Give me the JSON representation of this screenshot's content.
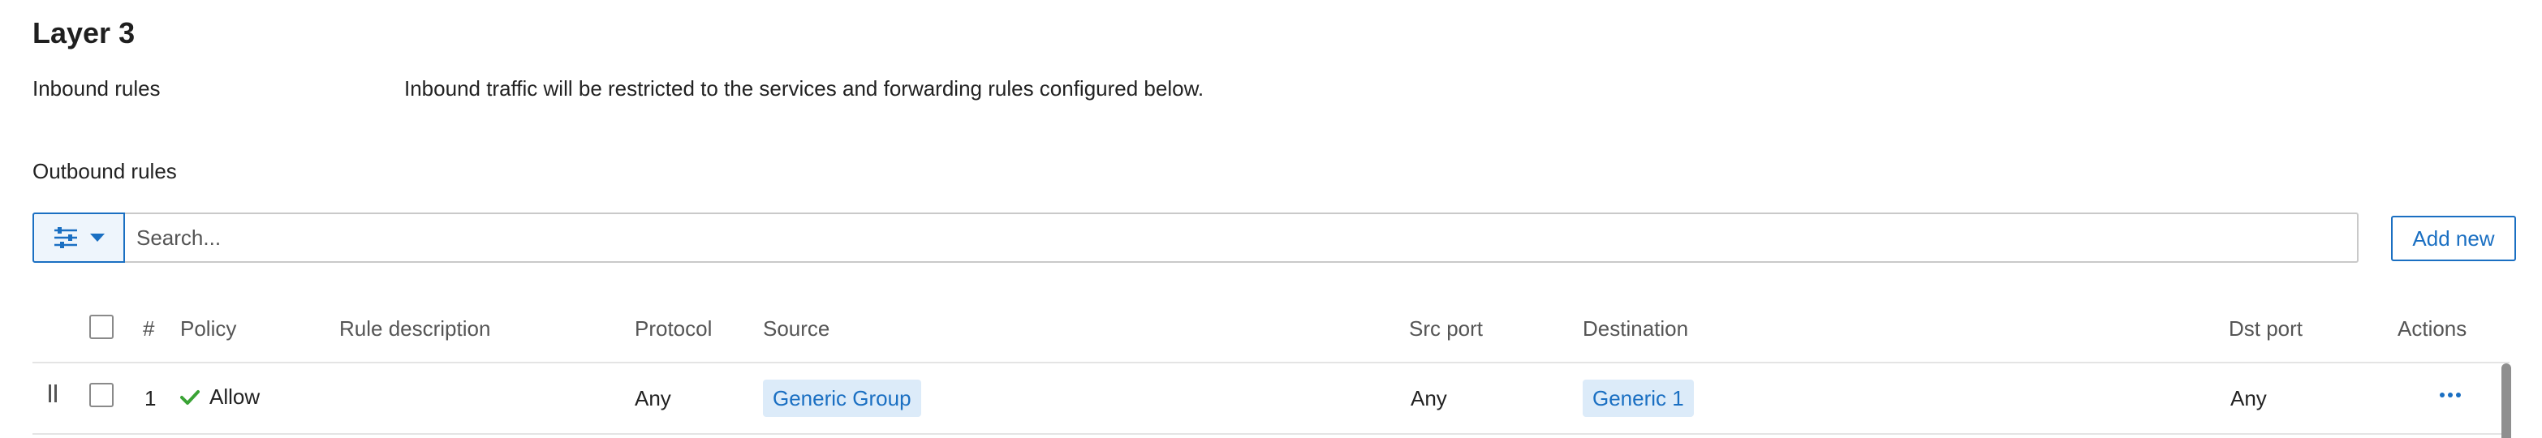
{
  "section": {
    "title": "Layer 3",
    "inbound_label": "Inbound rules",
    "inbound_description": "Inbound traffic will be restricted to the services and forwarding rules configured below.",
    "outbound_label": "Outbound rules"
  },
  "toolbar": {
    "filter_icon": "sliders-icon",
    "search_placeholder": "Search...",
    "add_label": "Add new"
  },
  "table": {
    "columns": {
      "num": "#",
      "policy": "Policy",
      "description": "Rule description",
      "protocol": "Protocol",
      "source": "Source",
      "src_port": "Src port",
      "destination": "Destination",
      "dst_port": "Dst port",
      "actions": "Actions"
    },
    "rows": [
      {
        "num": "1",
        "policy": "Allow",
        "description": "",
        "protocol": "Any",
        "source": "Generic Group",
        "src_port": "Any",
        "destination": "Generic 1",
        "dst_port": "Any"
      }
    ]
  },
  "colors": {
    "accent": "#1a6fc2",
    "allow": "#3aa335",
    "tag_bg": "#dcebf9"
  }
}
